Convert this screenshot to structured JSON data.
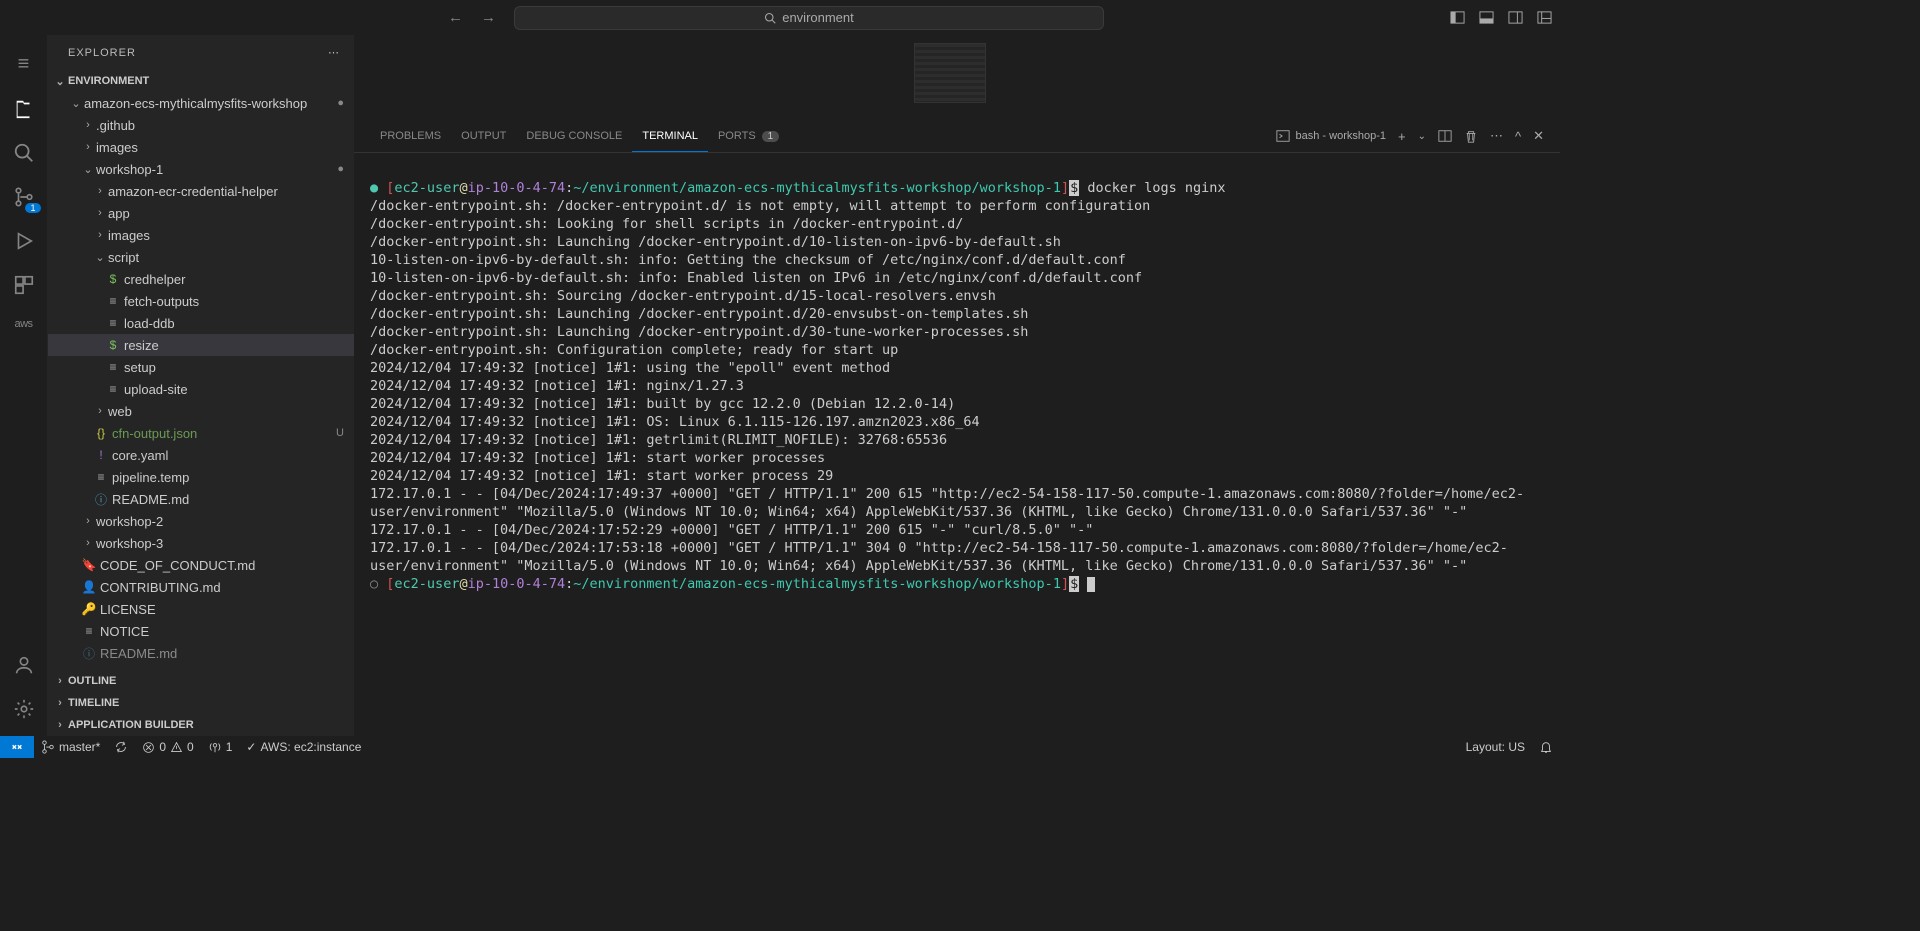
{
  "titlebar": {
    "search_text": "environment"
  },
  "activitybar": {
    "scm_badge": "1",
    "aws_label": "aws"
  },
  "sidebar": {
    "title": "EXPLORER",
    "sections": {
      "env": "ENVIRONMENT",
      "outline": "OUTLINE",
      "timeline": "TIMELINE",
      "appbuilder": "APPLICATION BUILDER"
    },
    "tree": {
      "root": "amazon-ecs-mythicalmysfits-workshop",
      "github": ".github",
      "images": "images",
      "ws1": "workshop-1",
      "ecr_helper": "amazon-ecr-credential-helper",
      "app": "app",
      "images2": "images",
      "script": "script",
      "credhelper": "credhelper",
      "fetch": "fetch-outputs",
      "loadddb": "load-ddb",
      "resize": "resize",
      "setup": "setup",
      "upload": "upload-site",
      "web": "web",
      "cfn": "cfn-output.json",
      "cfn_status": "U",
      "core": "core.yaml",
      "pipeline": "pipeline.temp",
      "readme1": "README.md",
      "ws2": "workshop-2",
      "ws3": "workshop-3",
      "coc": "CODE_OF_CONDUCT.md",
      "contrib": "CONTRIBUTING.md",
      "license": "LICENSE",
      "notice": "NOTICE",
      "readme2": "README.md"
    }
  },
  "panel": {
    "tabs": {
      "problems": "PROBLEMS",
      "output": "OUTPUT",
      "debug": "DEBUG CONSOLE",
      "terminal": "TERMINAL",
      "ports": "PORTS",
      "ports_count": "1"
    },
    "term_label": "bash - workshop-1"
  },
  "terminal": {
    "prompt_user": "ec2-user",
    "prompt_host": "ip-10-0-4-74",
    "prompt_path": "~/environment/amazon-ecs-mythicalmysfits-workshop/workshop-1",
    "cmd1": " docker logs nginx",
    "lines": [
      "/docker-entrypoint.sh: /docker-entrypoint.d/ is not empty, will attempt to perform configuration",
      "/docker-entrypoint.sh: Looking for shell scripts in /docker-entrypoint.d/",
      "/docker-entrypoint.sh: Launching /docker-entrypoint.d/10-listen-on-ipv6-by-default.sh",
      "10-listen-on-ipv6-by-default.sh: info: Getting the checksum of /etc/nginx/conf.d/default.conf",
      "10-listen-on-ipv6-by-default.sh: info: Enabled listen on IPv6 in /etc/nginx/conf.d/default.conf",
      "/docker-entrypoint.sh: Sourcing /docker-entrypoint.d/15-local-resolvers.envsh",
      "/docker-entrypoint.sh: Launching /docker-entrypoint.d/20-envsubst-on-templates.sh",
      "/docker-entrypoint.sh: Launching /docker-entrypoint.d/30-tune-worker-processes.sh",
      "/docker-entrypoint.sh: Configuration complete; ready for start up",
      "2024/12/04 17:49:32 [notice] 1#1: using the \"epoll\" event method",
      "2024/12/04 17:49:32 [notice] 1#1: nginx/1.27.3",
      "2024/12/04 17:49:32 [notice] 1#1: built by gcc 12.2.0 (Debian 12.2.0-14)",
      "2024/12/04 17:49:32 [notice] 1#1: OS: Linux 6.1.115-126.197.amzn2023.x86_64",
      "2024/12/04 17:49:32 [notice] 1#1: getrlimit(RLIMIT_NOFILE): 32768:65536",
      "2024/12/04 17:49:32 [notice] 1#1: start worker processes",
      "2024/12/04 17:49:32 [notice] 1#1: start worker process 29",
      "172.17.0.1 - - [04/Dec/2024:17:49:37 +0000] \"GET / HTTP/1.1\" 200 615 \"http://ec2-54-158-117-50.compute-1.amazonaws.com:8080/?folder=/home/ec2-user/environment\" \"Mozilla/5.0 (Windows NT 10.0; Win64; x64) AppleWebKit/537.36 (KHTML, like Gecko) Chrome/131.0.0.0 Safari/537.36\" \"-\"",
      "172.17.0.1 - - [04/Dec/2024:17:52:29 +0000] \"GET / HTTP/1.1\" 200 615 \"-\" \"curl/8.5.0\" \"-\"",
      "172.17.0.1 - - [04/Dec/2024:17:53:18 +0000] \"GET / HTTP/1.1\" 304 0 \"http://ec2-54-158-117-50.compute-1.amazonaws.com:8080/?folder=/home/ec2-user/environment\" \"Mozilla/5.0 (Windows NT 10.0; Win64; x64) AppleWebKit/537.36 (KHTML, like Gecko) Chrome/131.0.0.0 Safari/537.36\" \"-\""
    ]
  },
  "statusbar": {
    "branch": "master*",
    "sync": "",
    "errors": "0",
    "warnings": "0",
    "ports_fwd": "1",
    "aws": "AWS: ec2:instance",
    "layout": "Layout: US"
  }
}
